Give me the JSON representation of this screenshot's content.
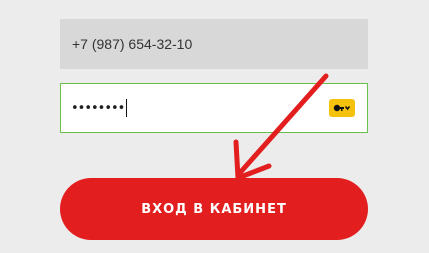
{
  "form": {
    "phone_value": "+7 (987) 654-32-10",
    "password_masked": "••••••••",
    "login_button_label": "ВХОД В КАБИНЕТ"
  },
  "icons": {
    "password_manager": "key-dropdown-icon",
    "annotation": "red-arrow-annotation"
  },
  "colors": {
    "background": "#ececec",
    "phone_field_bg": "#d8d8d8",
    "password_border": "#6abf4b",
    "button": "#e31e1e",
    "key_badge": "#f4c20d",
    "arrow": "#e31e1e"
  }
}
